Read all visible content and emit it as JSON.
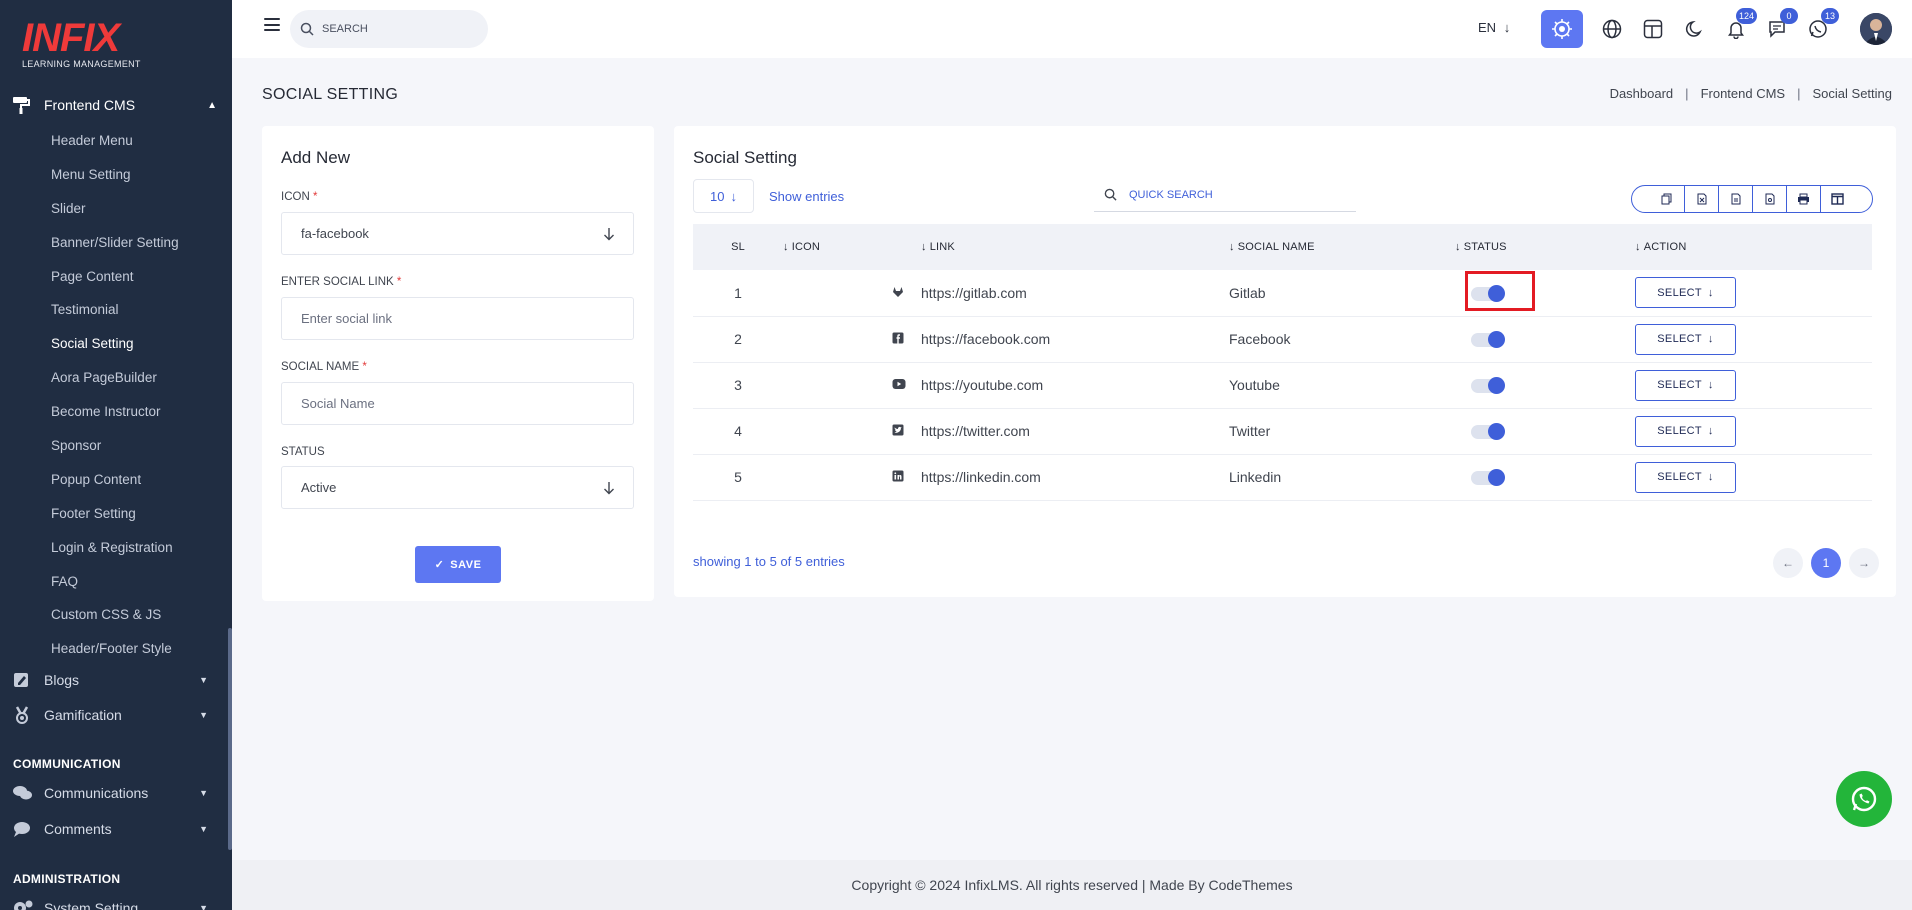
{
  "sidebar": {
    "logo_text": "INFIX",
    "logo_sub": "LEARNING MANAGEMENT",
    "frontend_cms_label": "Frontend CMS",
    "submenu": [
      "Header Menu",
      "Menu Setting",
      "Slider",
      "Banner/Slider Setting",
      "Page Content",
      "Testimonial",
      "Social Setting",
      "Aora PageBuilder",
      "Become Instructor",
      "Sponsor",
      "Popup Content",
      "Footer Setting",
      "Login & Registration",
      "FAQ",
      "Custom CSS & JS",
      "Header/Footer Style"
    ],
    "active_item": "Social Setting",
    "blogs_label": "Blogs",
    "gamification_label": "Gamification",
    "communication_title": "COMMUNICATION",
    "communications_label": "Communications",
    "comments_label": "Comments",
    "administration_title": "ADMINISTRATION",
    "system_setting_label": "System Setting"
  },
  "topbar": {
    "search_placeholder": "SEARCH",
    "language": "EN",
    "notifications_count": "124",
    "messages_count": "0",
    "chat_count": "13",
    "accent_color": "#5d77f2"
  },
  "page": {
    "title": "SOCIAL SETTING",
    "breadcrumb": [
      "Dashboard",
      "Frontend CMS",
      "Social Setting"
    ]
  },
  "form": {
    "title": "Add New",
    "icon_label": "ICON",
    "icon_value": "fa-facebook",
    "link_label": "ENTER SOCIAL LINK",
    "link_placeholder": "Enter social link",
    "name_label": "SOCIAL NAME",
    "name_placeholder": "Social Name",
    "status_label": "STATUS",
    "status_value": "Active",
    "required_mark": "*",
    "save_label": "SAVE"
  },
  "table": {
    "title": "Social Setting",
    "entries_value": "10",
    "show_entries_label": "Show entries",
    "quick_search_placeholder": "QUICK SEARCH",
    "columns": [
      "SL",
      "ICON",
      "LINK",
      "SOCIAL NAME",
      "STATUS",
      "ACTION"
    ],
    "rows": [
      {
        "sl": "1",
        "icon": "gitlab-icon",
        "link": "https://gitlab.com",
        "name": "Gitlab",
        "status": true
      },
      {
        "sl": "2",
        "icon": "facebook-icon",
        "link": "https://facebook.com",
        "name": "Facebook",
        "status": true
      },
      {
        "sl": "3",
        "icon": "youtube-icon",
        "link": "https://youtube.com",
        "name": "Youtube",
        "status": true
      },
      {
        "sl": "4",
        "icon": "twitter-icon",
        "link": "https://twitter.com",
        "name": "Twitter",
        "status": true
      },
      {
        "sl": "5",
        "icon": "linkedin-icon",
        "link": "https://linkedin.com",
        "name": "Linkedin",
        "status": true
      }
    ],
    "action_label": "SELECT",
    "showing_text": "showing 1 to 5 of 5 entries",
    "current_page": "1"
  },
  "footer": {
    "copyright": "Copyright © 2024 InfixLMS. All rights reserved | Made By CodeThemes"
  }
}
